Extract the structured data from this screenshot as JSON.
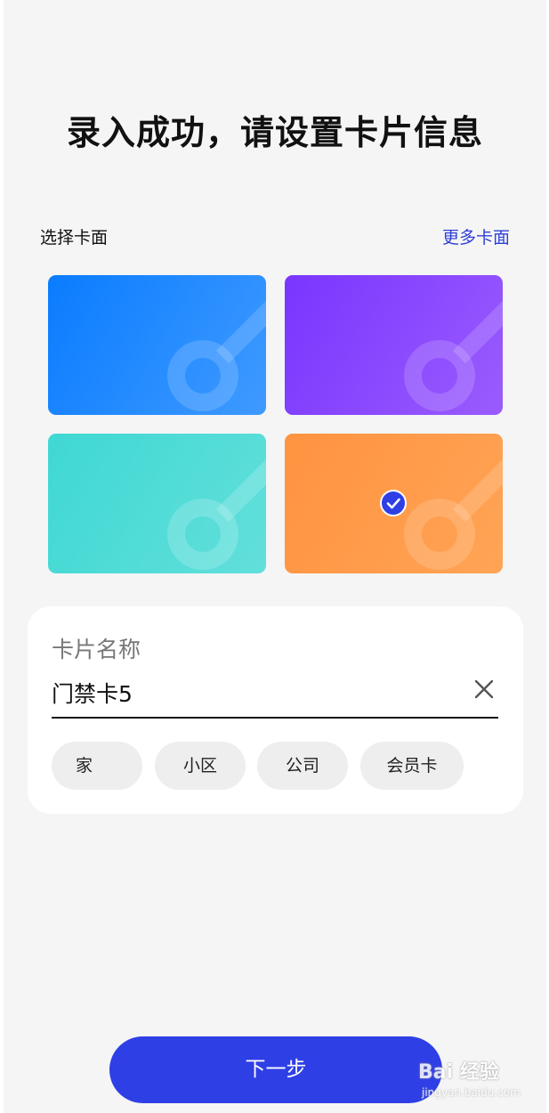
{
  "page": {
    "title": "录入成功，请设置卡片信息"
  },
  "card_faces": {
    "label": "选择卡面",
    "more_link": "更多卡面",
    "options": [
      {
        "color": "#0a7cff",
        "selected": false
      },
      {
        "color": "#7a35ff",
        "selected": false
      },
      {
        "color": "#3fd8d3",
        "selected": false
      },
      {
        "color": "#ff9340",
        "selected": true
      }
    ],
    "selected_check_icon": "checkmark-circle-icon"
  },
  "card_name": {
    "label": "卡片名称",
    "value": "门禁卡5",
    "clear_icon": "close-icon",
    "suggestions": [
      "家",
      "小区",
      "公司",
      "会员卡"
    ]
  },
  "footer": {
    "next_label": "下一步"
  },
  "watermark": {
    "brand": "Bai 经验",
    "sub": "jingyan.baidu.com"
  },
  "colors": {
    "accent": "#2f3fe6",
    "link": "#2f3fd6",
    "background": "#f5f5f5"
  }
}
